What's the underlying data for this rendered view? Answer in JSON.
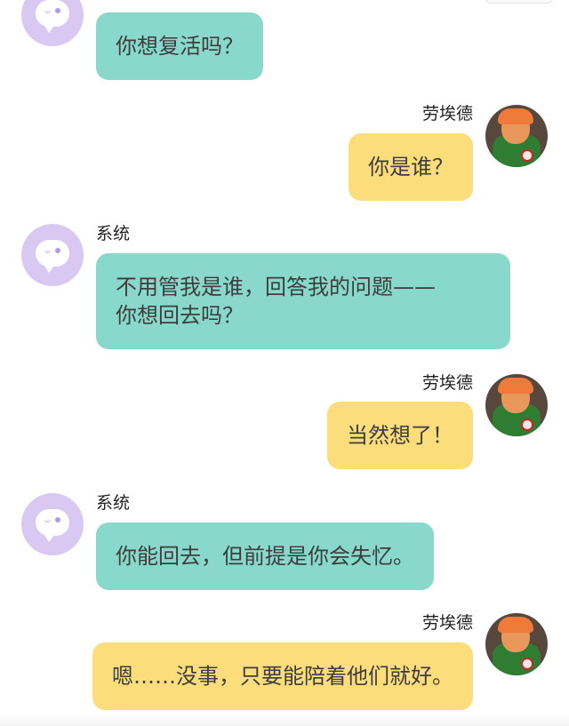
{
  "colors": {
    "system_bubble": "#88d9cc",
    "user_bubble": "#fcdd7b",
    "system_avatar": "#d9c9f2"
  },
  "messages": [
    {
      "sender": "system",
      "name": "",
      "text": "你想复活吗？"
    },
    {
      "sender": "user",
      "name": "劳埃德",
      "text": "你是谁？"
    },
    {
      "sender": "system",
      "name": "系统",
      "line1": "不用管我是谁，回答我的问题——",
      "line2": "你想回去吗？"
    },
    {
      "sender": "user",
      "name": "劳埃德",
      "text": "当然想了！"
    },
    {
      "sender": "system",
      "name": "系统",
      "text": "你能回去，但前提是你会失忆。"
    },
    {
      "sender": "user",
      "name": "劳埃德",
      "text": "嗯……没事，只要能陪着他们就好。"
    }
  ],
  "icons": {
    "system_avatar": "chat-bubble-face-icon",
    "user_avatar": "lego-character-avatar"
  }
}
